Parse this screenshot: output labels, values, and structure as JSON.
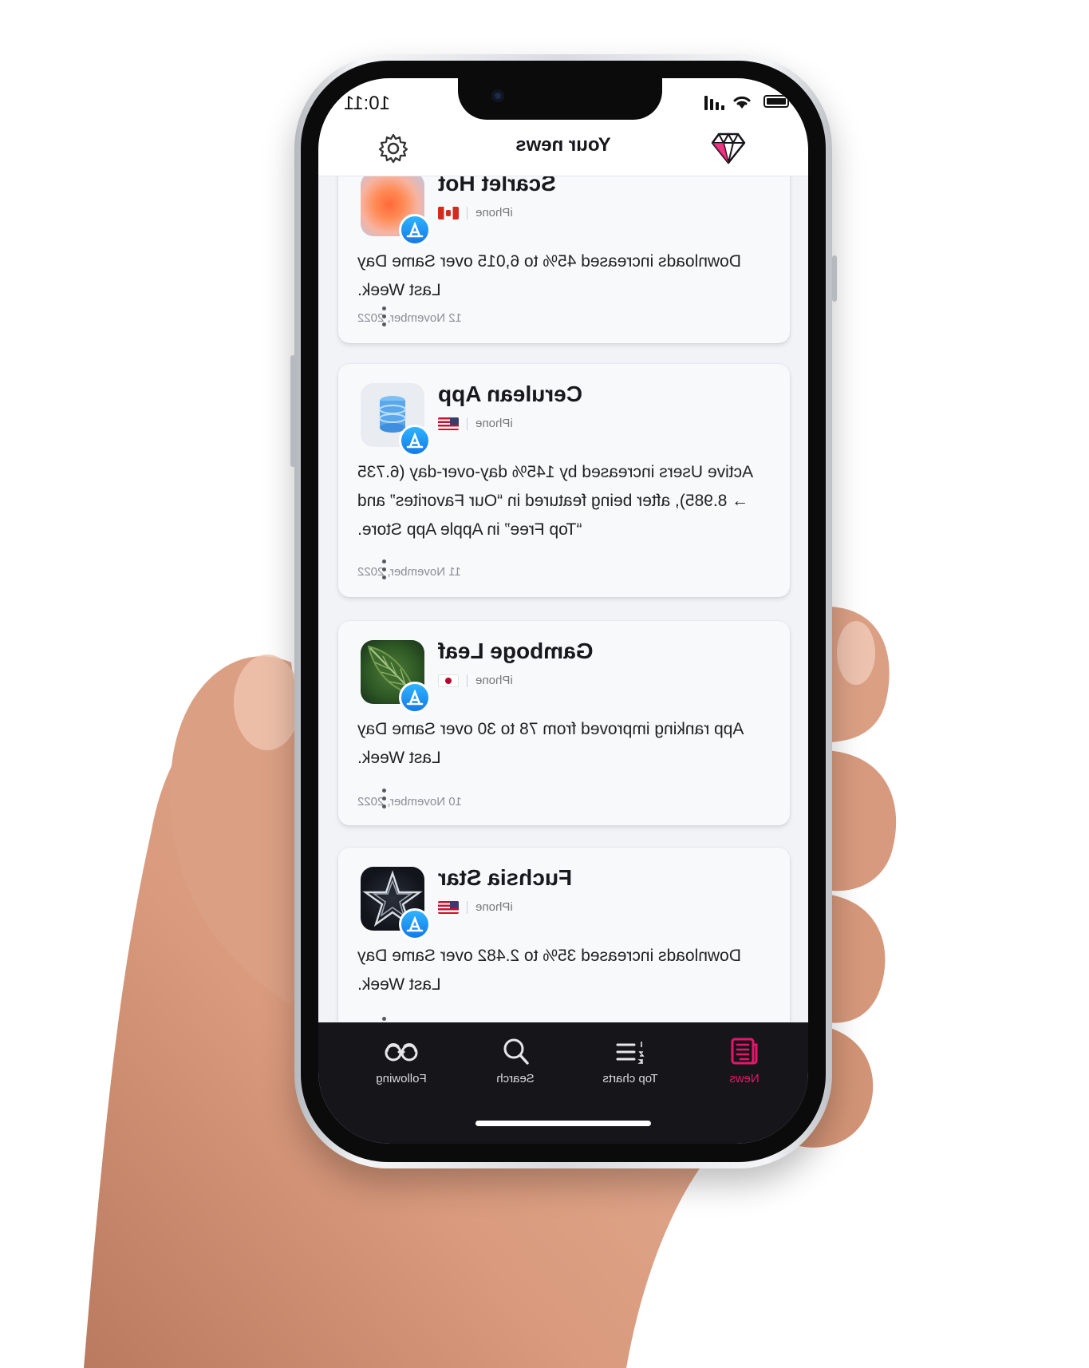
{
  "status_bar": {
    "time": "10:11"
  },
  "header": {
    "title": "Your news",
    "left_icon": "diamond-icon",
    "right_icon": "gear-icon"
  },
  "cards": [
    {
      "app_name": "Scarlet Hot",
      "platform": "iPhone",
      "country_flag": "canada-flag",
      "icon": "orange-blob-app-icon",
      "store_badge": "app-store-icon",
      "text": "Downloads increased 45% to 6,015 over Same Day Last Week.",
      "date": "12 November, 2022"
    },
    {
      "app_name": "Cerulean App",
      "platform": "iPhone",
      "country_flag": "usa-flag",
      "icon": "database-app-icon",
      "store_badge": "app-store-icon",
      "text": "Active Users increased by 145% day-over-day (6.735 → 8.985), after being featured in “Our Favorites” and “Top Free” in Apple App Store.",
      "date": "11 November, 2022"
    },
    {
      "app_name": "Gamboge Leaf",
      "platform": "iPhone",
      "country_flag": "japan-flag",
      "icon": "leaf-app-icon",
      "store_badge": "app-store-icon",
      "text": "App ranking improved from 78 to 30 over Same Day Last Week.",
      "date": "10 November, 2022"
    },
    {
      "app_name": "Fuchsia Star",
      "platform": "iPhone",
      "country_flag": "usa-flag",
      "icon": "star-app-icon",
      "store_badge": "app-store-icon",
      "text": "Downloads increased 35% to 2.482 over Same Day Last Week."
    }
  ],
  "tabbar": {
    "tabs": [
      {
        "label": "News",
        "icon": "newspaper-icon",
        "active": true
      },
      {
        "label": "Top charts",
        "icon": "ranked-list-icon",
        "active": false
      },
      {
        "label": "Search",
        "icon": "search-icon",
        "active": false
      },
      {
        "label": "Following",
        "icon": "binoculars-icon",
        "active": false
      }
    ]
  },
  "colors": {
    "accent": "#e5156c",
    "tabbar_bg": "#16161a",
    "card_bg": "#f8f9fb",
    "screen_bg": "#f2f3f6"
  }
}
